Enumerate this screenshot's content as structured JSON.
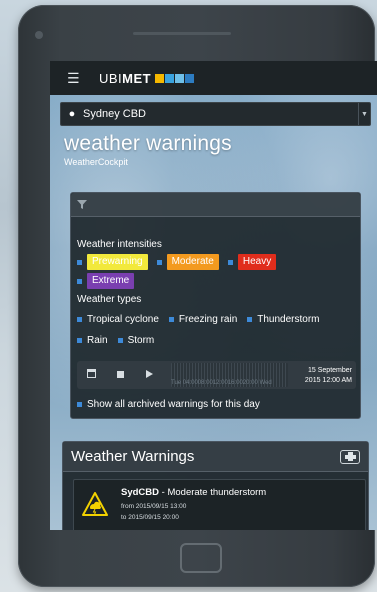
{
  "app": {
    "brand_ubi": "UBI",
    "brand_met": "MET",
    "menu_icon": "hamburger-icon"
  },
  "location": {
    "icon": "map-pin-icon",
    "value": "Sydney CBD"
  },
  "page": {
    "title": "weather warnings",
    "subtitle": "WeatherCockpit"
  },
  "filters": {
    "header_icon": "funnel-icon",
    "intensities_label": "Weather intensities",
    "intensities": [
      {
        "label": "Prewarning",
        "color": "#f2e93c",
        "text_color": "#ffffff"
      },
      {
        "label": "Moderate",
        "color": "#f39a1f",
        "text_color": "#ffffff"
      },
      {
        "label": "Heavy",
        "color": "#e02d1c",
        "text_color": "#ffffff"
      },
      {
        "label": "Extreme",
        "color": "#7a3fb0",
        "text_color": "#ffffff"
      }
    ],
    "types_label": "Weather types",
    "types": [
      "Tropical cyclone",
      "Freezing rain",
      "Thunderstorm",
      "Rain",
      "Storm"
    ],
    "timeline": {
      "ticks": "Tue 04:0008:0012:0016:0020:00 Wed",
      "date_line1": "15 September",
      "date_line2": "2015 12:00 AM"
    },
    "archive_label": "Show all archived warnings for this day"
  },
  "warnings": {
    "title": "Weather Warnings",
    "print_icon": "print-icon",
    "items": [
      {
        "area": "SydCBD",
        "description": " - Moderate thunderstorm",
        "from": "from 2015/09/15 13:00",
        "to": "to 2015/09/15 20:00",
        "icon": "thunderstorm-warning-icon",
        "icon_color": "#f2d100"
      }
    ]
  },
  "colors": {
    "accent_bullet": "#3d8ad9",
    "navbar": "#1d2326"
  }
}
